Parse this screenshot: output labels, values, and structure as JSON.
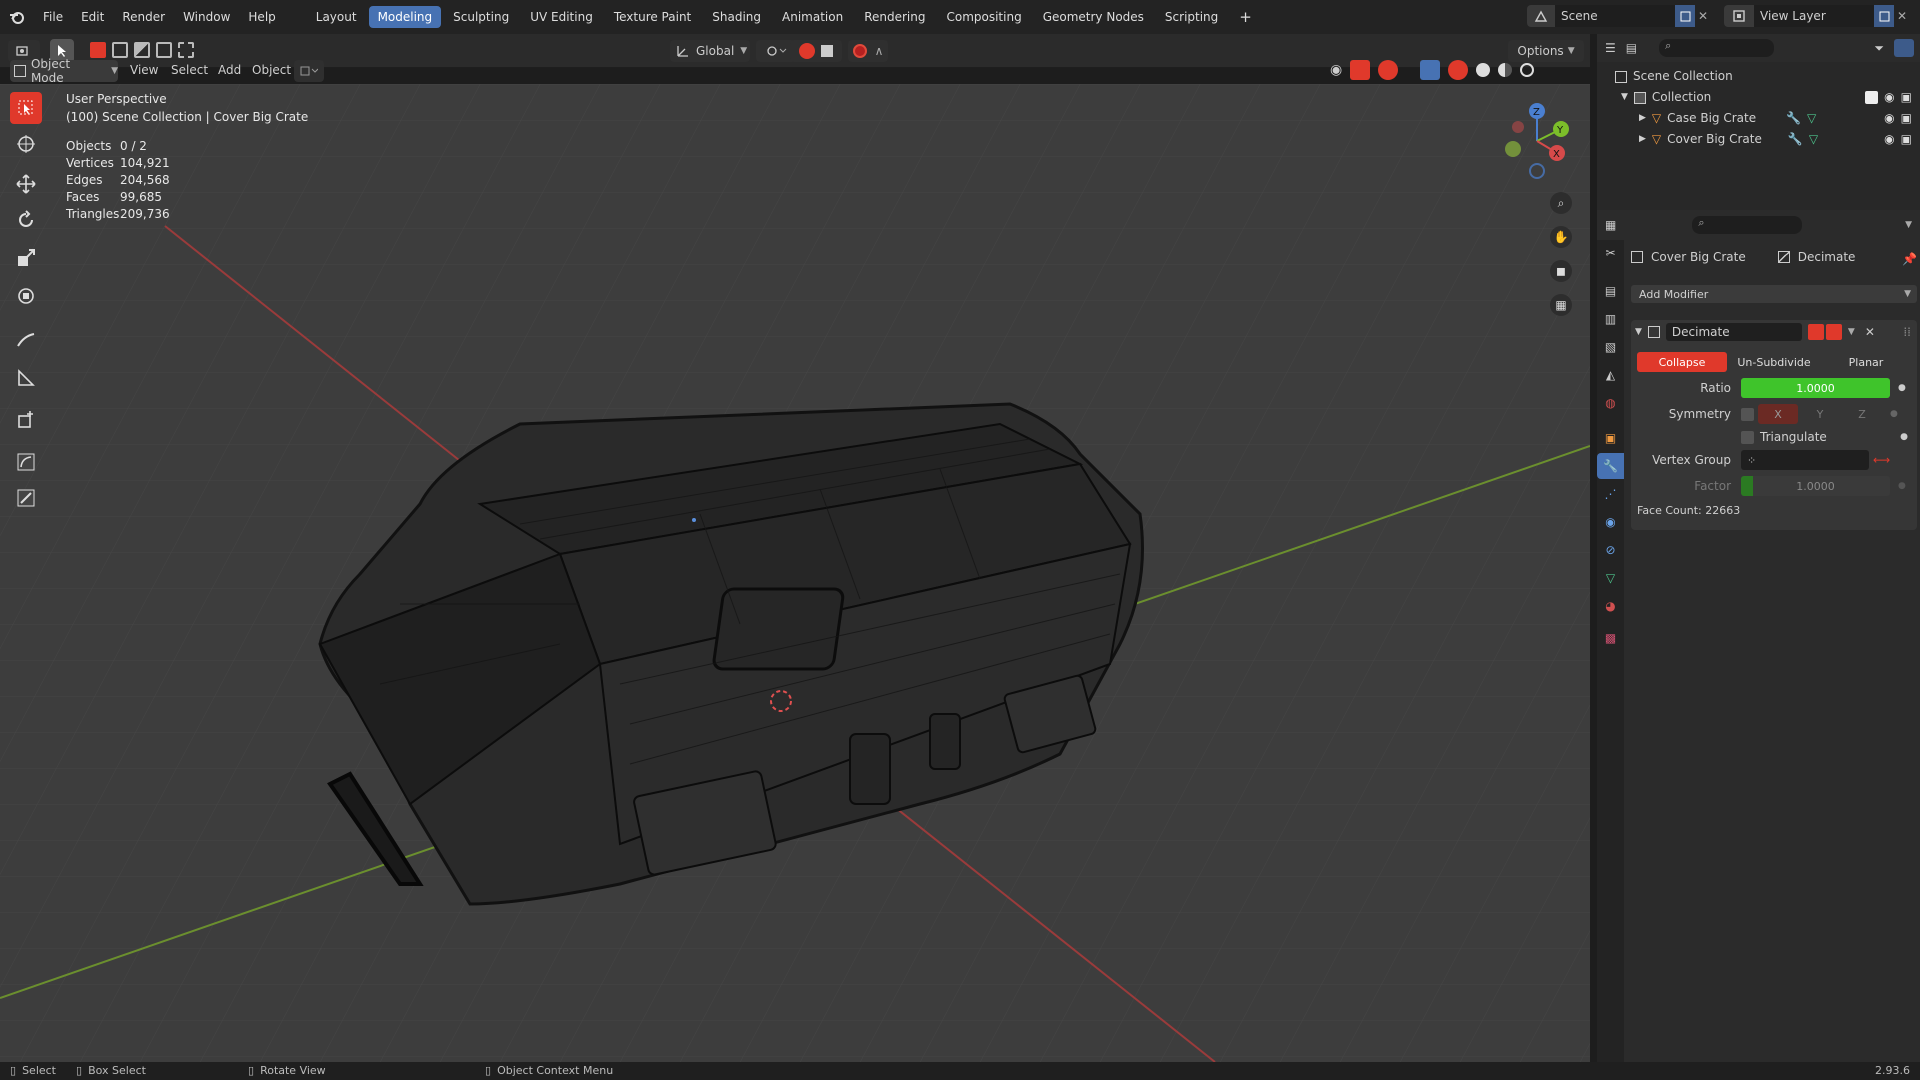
{
  "menu": [
    "File",
    "Edit",
    "Render",
    "Window",
    "Help"
  ],
  "workspaces": [
    "Layout",
    "Modeling",
    "Sculpting",
    "UV Editing",
    "Texture Paint",
    "Shading",
    "Animation",
    "Rendering",
    "Compositing",
    "Geometry Nodes",
    "Scripting"
  ],
  "active_workspace": "Modeling",
  "scene": {
    "label": "Scene"
  },
  "view_layer": {
    "label": "View Layer"
  },
  "toolbar": {
    "orientation": "Global",
    "options_label": "Options"
  },
  "header": {
    "mode": "Object Mode",
    "menus": [
      "View",
      "Select",
      "Add",
      "Object"
    ]
  },
  "viewport": {
    "perspective": "User Perspective",
    "collection_info": "(100) Scene Collection | Cover Big Crate",
    "stats": [
      {
        "label": "Objects",
        "value": "0 / 2"
      },
      {
        "label": "Vertices",
        "value": "104,921"
      },
      {
        "label": "Edges",
        "value": "204,568"
      },
      {
        "label": "Faces",
        "value": "99,685"
      },
      {
        "label": "Triangles",
        "value": "209,736"
      }
    ],
    "gizmo": {
      "x": "X",
      "y": "Y",
      "z": "Z"
    }
  },
  "outliner": {
    "root": "Scene Collection",
    "collection": "Collection",
    "items": [
      "Case Big Crate",
      "Cover Big Crate"
    ]
  },
  "properties": {
    "object_name": "Cover Big Crate",
    "modifier_breadcrumb": "Decimate",
    "add_modifier": "Add Modifier",
    "modifier": {
      "name": "Decimate",
      "tabs": [
        "Collapse",
        "Un-Subdivide",
        "Planar"
      ],
      "active_tab": "Collapse",
      "ratio_label": "Ratio",
      "ratio_value": "1.0000",
      "ratio_fraction": 1.0,
      "symmetry_label": "Symmetry",
      "axes": [
        "X",
        "Y",
        "Z"
      ],
      "triangulate_label": "Triangulate",
      "vertex_group_label": "Vertex Group",
      "factor_label": "Factor",
      "factor_value": "1.0000",
      "face_count": "Face Count: 22663"
    }
  },
  "statusbar": {
    "items": [
      "Select",
      "Box Select",
      "Rotate View",
      "Object Context Menu"
    ],
    "version": "2.93.6"
  },
  "colors": {
    "accent": "#4772b3",
    "active_red": "#e0392b",
    "ratio_green": "#3fc42b",
    "header_bg": "#232323"
  }
}
